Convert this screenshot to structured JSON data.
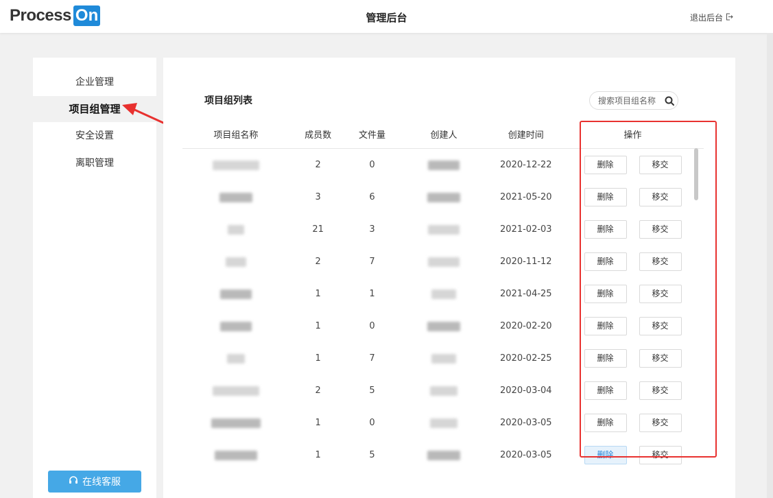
{
  "header": {
    "logo_text": "Process",
    "logo_on": "On",
    "title": "管理后台",
    "logout_label": "退出后台",
    "logout_icon": "logout-icon"
  },
  "sidebar": {
    "items": [
      {
        "label": "企业管理",
        "active": false
      },
      {
        "label": "项目组管理",
        "active": true
      },
      {
        "label": "安全设置",
        "active": false
      },
      {
        "label": "离职管理",
        "active": false
      }
    ],
    "service_label": "在线客服",
    "service_icon": "headset-icon"
  },
  "main": {
    "list_title": "项目组列表",
    "search_placeholder": "搜索项目组名称",
    "columns": [
      "项目组名称",
      "成员数",
      "文件量",
      "创建人",
      "创建时间",
      "操作"
    ],
    "delete_label": "删除",
    "transfer_label": "移交",
    "rows": [
      {
        "members": "2",
        "files": "0",
        "created": "2020-12-22"
      },
      {
        "members": "3",
        "files": "6",
        "created": "2021-05-20"
      },
      {
        "members": "21",
        "files": "3",
        "created": "2021-02-03"
      },
      {
        "members": "2",
        "files": "7",
        "created": "2020-11-12"
      },
      {
        "members": "1",
        "files": "1",
        "created": "2021-04-25"
      },
      {
        "members": "1",
        "files": "0",
        "created": "2020-02-20"
      },
      {
        "members": "1",
        "files": "7",
        "created": "2020-02-25"
      },
      {
        "members": "2",
        "files": "5",
        "created": "2020-03-04"
      },
      {
        "members": "1",
        "files": "0",
        "created": "2020-03-05"
      },
      {
        "members": "1",
        "files": "5",
        "created": "2020-03-05"
      }
    ]
  },
  "colors": {
    "accent": "#1f8ad9",
    "service_button": "#45a8e6",
    "annotation_red": "#e8312f"
  }
}
